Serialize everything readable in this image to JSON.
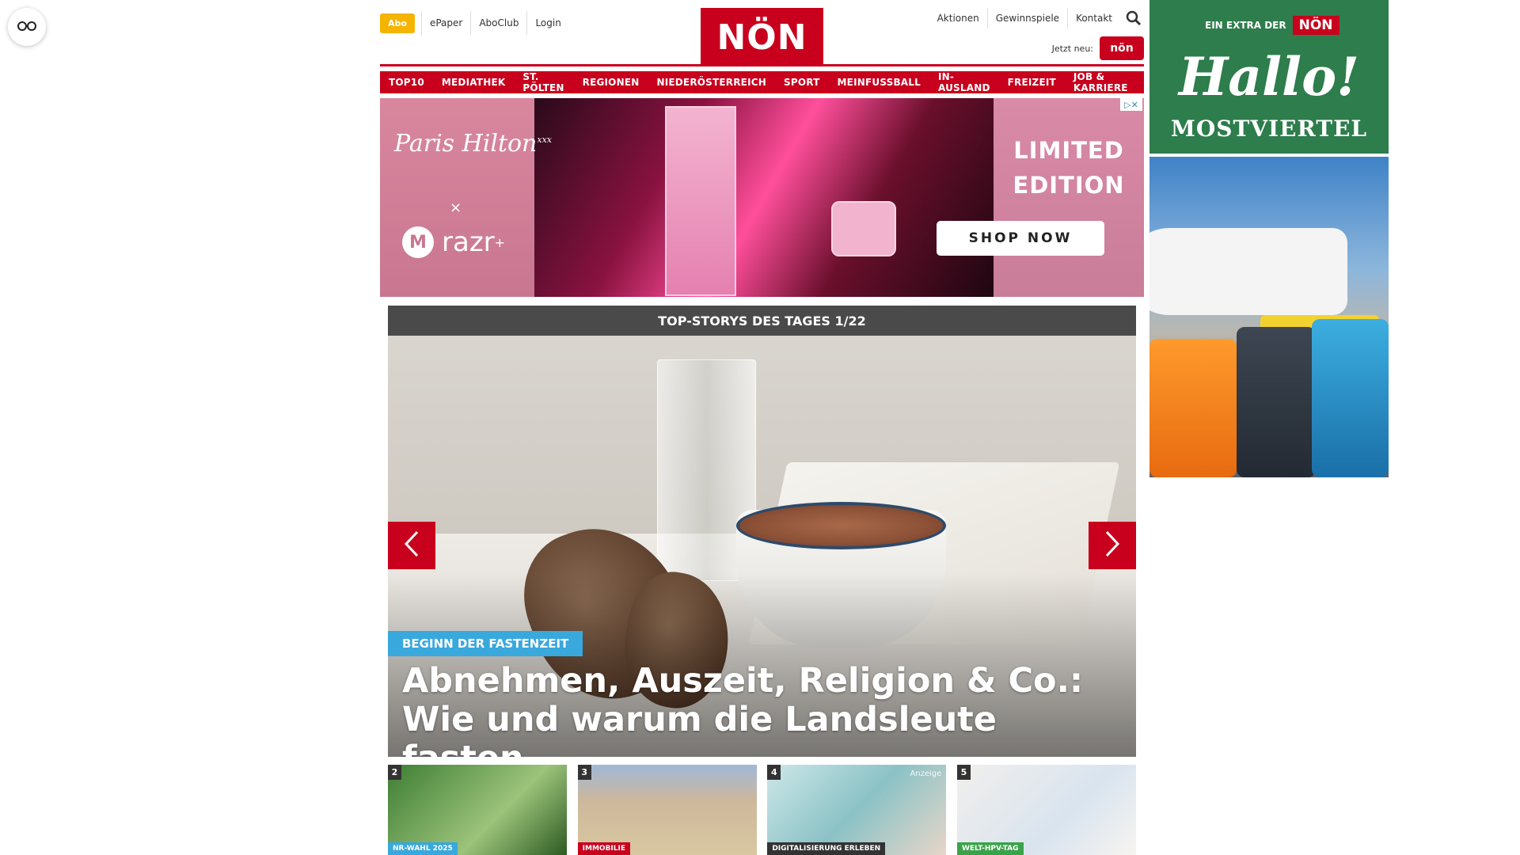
{
  "topbar": {
    "abo_label": "Abo",
    "left_links": [
      "ePaper",
      "AboClub",
      "Login"
    ],
    "logo_text": "NÖN",
    "right_links": [
      "Aktionen",
      "Gewinnspiele",
      "Kontakt"
    ],
    "jetzt_label": "Jetzt neu:",
    "jetzt_badge": "nön"
  },
  "nav": [
    "TOP10",
    "MEDIATHEK",
    "ST. PÖLTEN",
    "REGIONEN",
    "NIEDERÖSTERREICH",
    "SPORT",
    "MEINFUSSBALL",
    "IN-AUSLAND",
    "FREIZEIT",
    "JOB & KARRIERE"
  ],
  "ad_banner": {
    "brand": "Paris Hilton",
    "brand_sup": "xxx",
    "x": "×",
    "razr": "razr",
    "razr_sup": "+",
    "limited": "LIMITED EDITION",
    "cta": "SHOP NOW",
    "choice": "▷✕"
  },
  "slider": {
    "header": "TOP-STORYS DES TAGES 1/22",
    "tag": "BEGINN DER FASTENZEIT",
    "title": "Abnehmen, Auszeit, Religion & Co.: Wie und warum die Landsleute fasten",
    "tag_color": "#38a8dd"
  },
  "thumbs": [
    {
      "num": "2",
      "tag": "NR-WAHL 2025",
      "tag_color": "#38a8dd"
    },
    {
      "num": "3",
      "tag": "IMMOBILIE",
      "tag_color": "#c8001d"
    },
    {
      "num": "4",
      "tag": "DIGITALISIERUNG ERLEBEN",
      "tag_color": "#333333",
      "anzeige": "Anzeige"
    },
    {
      "num": "5",
      "tag": "WELT-HPV-TAG",
      "tag_color": "#3aa34a"
    }
  ],
  "side_ad": {
    "extra": "EIN EXTRA DER",
    "extra_logo": "NÖN",
    "hallo": "Hallo!",
    "mostviertel": "MOSTVIERTEL"
  },
  "colors": {
    "brand_red": "#c8001d",
    "abo_yellow": "#f5b400",
    "side_green": "#2e7d4c"
  }
}
